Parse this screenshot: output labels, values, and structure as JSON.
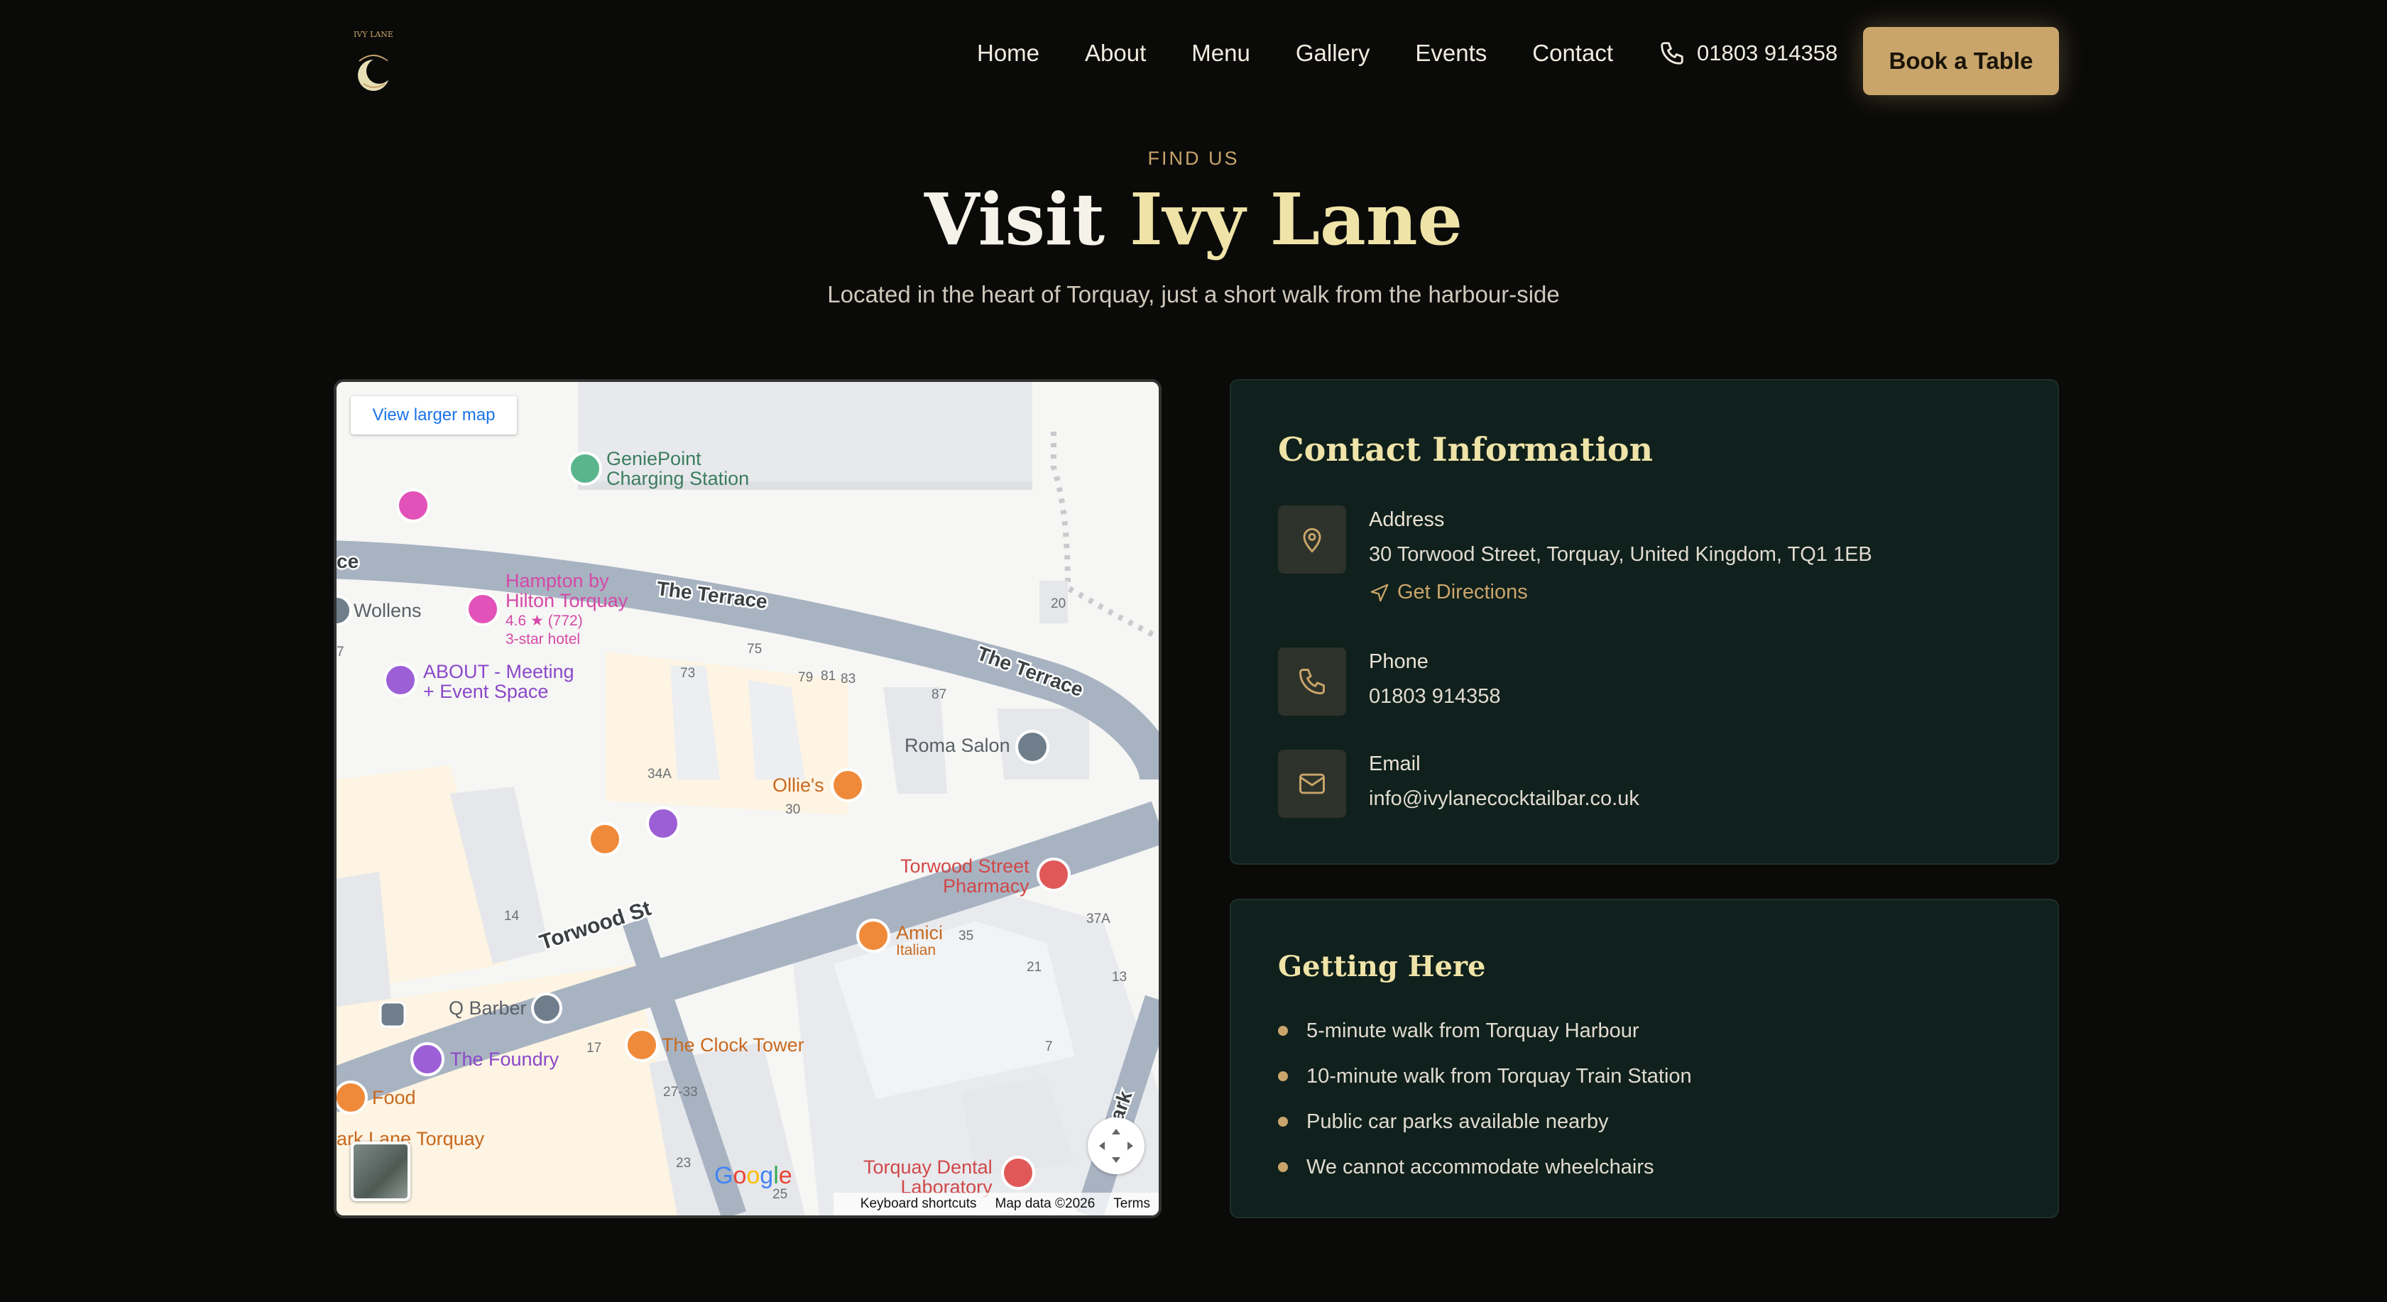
{
  "nav": {
    "items": [
      "Home",
      "About",
      "Menu",
      "Gallery",
      "Events",
      "Contact"
    ],
    "phone": "01803 914358",
    "book_label": "Book a Table",
    "logo_text": "IVY LANE"
  },
  "hero": {
    "eyebrow": "FIND US",
    "title_plain": "Visit",
    "title_accent": "Ivy Lane",
    "subtitle": "Located in the heart of Torquay, just a short walk from the harbour-side"
  },
  "map": {
    "view_larger": "View larger map",
    "footer": {
      "shortcuts": "Keyboard shortcuts",
      "data": "Map data ©2026",
      "terms": "Terms"
    },
    "streets": {
      "terrace_left": "The Terrace",
      "terrace_right": "The Terrace",
      "torwood": "Torwood St",
      "parkhill": "Park",
      "left_edge": "ce"
    },
    "places": {
      "geniepoint": "GeniePoint\nCharging Station",
      "hampton": "Hampton by\nHilton Torquay",
      "hampton_rating": "4.6 ★ (772)",
      "hampton_class": "3-star hotel",
      "wollens": "Wollens",
      "about": "ABOUT - Meeting\n+ Event Space",
      "roma": "Roma Salon",
      "ollies": "Ollie's",
      "pharmacy": "Torwood Street\nPharmacy",
      "amici": "Amici",
      "amici_type": "Italian",
      "qbarber": "Q Barber",
      "foundry": "The Foundry",
      "clocktower": "The Clock Tower",
      "food": "Food",
      "parklane": "ark Lane Torquay",
      "dental": "Torquay Dental\nLaboratory"
    },
    "numbers": [
      "20",
      "75",
      "73",
      "79",
      "81",
      "83",
      "87",
      "34A",
      "30",
      "14",
      "37A",
      "35",
      "21",
      "13",
      "17",
      "7",
      "27-33",
      "23",
      "25",
      "7"
    ]
  },
  "contact": {
    "title": "Contact Information",
    "address_label": "Address",
    "address": "30 Torwood Street, Torquay, United Kingdom, TQ1 1EB",
    "directions": "Get Directions",
    "phone_label": "Phone",
    "phone": "01803 914358",
    "email_label": "Email",
    "email": "info@ivylanecocktailbar.co.uk"
  },
  "getting_here": {
    "title": "Getting Here",
    "items": [
      "5-minute walk from Torquay Harbour",
      "10-minute walk from Torquay Train Station",
      "Public car parks available nearby",
      "We cannot accommodate wheelchairs"
    ]
  },
  "colors": {
    "accent_gold": "#c9a56b",
    "title_cream": "#efe3a8",
    "card_bg": "#10201c"
  }
}
